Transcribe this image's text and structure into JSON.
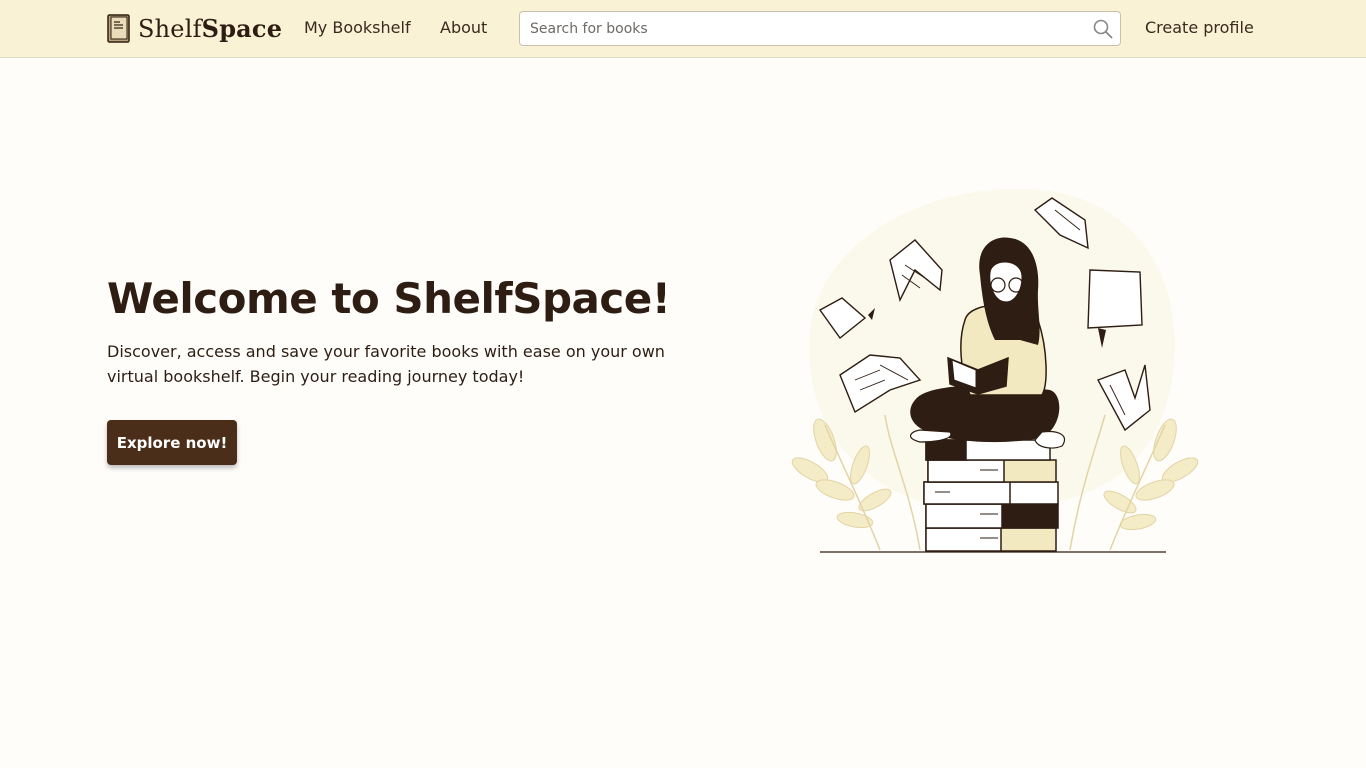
{
  "brand": {
    "name_light": "Shelf",
    "name_bold": "Space",
    "icon": "book-icon"
  },
  "nav": {
    "links": [
      {
        "label": "My Bookshelf"
      },
      {
        "label": "About"
      }
    ],
    "search": {
      "placeholder": "Search for books",
      "value": "",
      "icon": "search-icon"
    },
    "profile_label": "Create profile"
  },
  "hero": {
    "title": "Welcome to ShelfSpace!",
    "text": "Discover, access and save your favorite books with ease on your own virtual bookshelf. Begin your reading journey today!",
    "cta_label": "Explore now!",
    "illustration": "woman-reading-on-book-stack-illustration"
  },
  "colors": {
    "navbar_bg": "#faf2d4",
    "page_bg": "#fffdfa",
    "accent": "#4a2e1a",
    "text": "#2e1d12",
    "illustration_cream": "#f3e9c1"
  }
}
